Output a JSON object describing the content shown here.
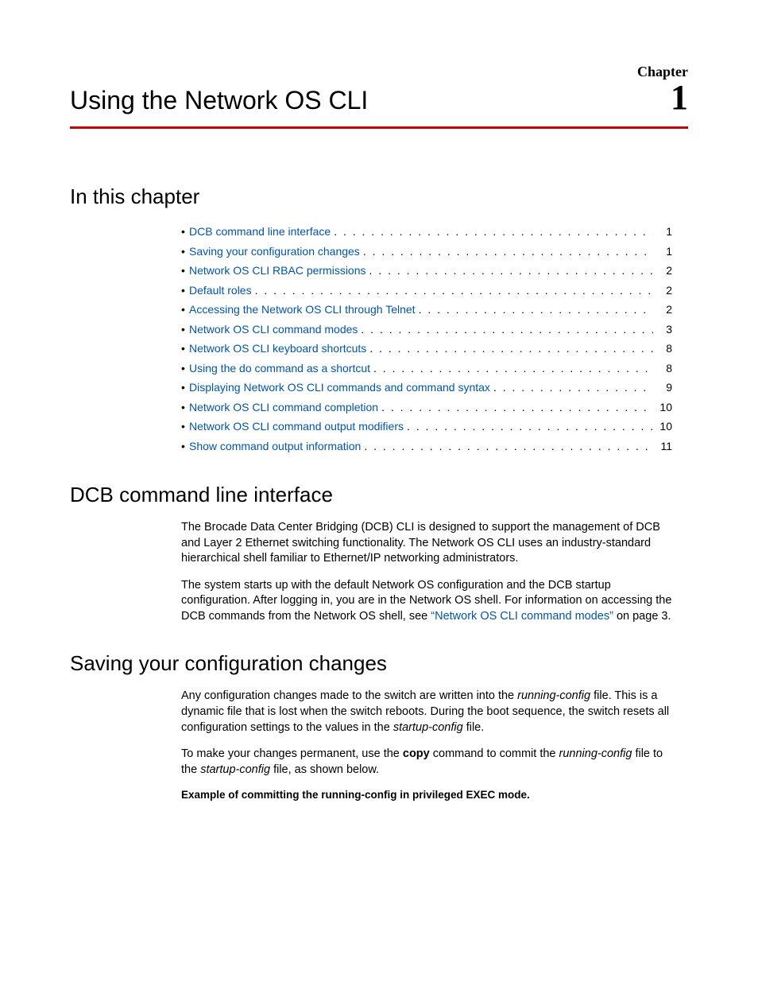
{
  "chapter": {
    "label": "Chapter",
    "number": "1",
    "title": "Using the Network OS CLI"
  },
  "sections": {
    "in_this_chapter": "In this chapter",
    "dcb": "DCB command line interface",
    "saving": "Saving your configuration changes"
  },
  "toc": [
    {
      "label": "DCB command line interface",
      "page": "1"
    },
    {
      "label": "Saving your configuration changes",
      "page": "1"
    },
    {
      "label": "Network OS CLI RBAC permissions",
      "page": "2"
    },
    {
      "label": "Default roles",
      "page": "2"
    },
    {
      "label": "Accessing the Network OS CLI through Telnet",
      "page": "2"
    },
    {
      "label": "Network OS CLI command modes",
      "page": "3"
    },
    {
      "label": "Network OS CLI keyboard shortcuts",
      "page": "8"
    },
    {
      "label": "Using the do command as a shortcut",
      "page": "8"
    },
    {
      "label": "Displaying Network OS CLI commands and command syntax",
      "page": "9"
    },
    {
      "label": "Network OS CLI command completion",
      "page": "10"
    },
    {
      "label": "Network OS CLI command output modifiers",
      "page": "10"
    },
    {
      "label": "Show command output information",
      "page": "11"
    }
  ],
  "body": {
    "dcb_p1": "The Brocade Data Center Bridging (DCB) CLI is designed to support the management of DCB and Layer 2 Ethernet switching functionality. The Network OS CLI uses an industry-standard hierarchical shell familiar to Ethernet/IP networking administrators.",
    "dcb_p2a": "The system starts up with the default Network OS configuration and the DCB startup configuration. After logging in, you are in the Network OS shell. For information on accessing the DCB commands from the Network OS shell, see ",
    "dcb_p2_xref": "“Network OS CLI command modes”",
    "dcb_p2b": " on page 3.",
    "saving_p1a": "Any configuration changes made to the switch are written into the ",
    "saving_p1_i1": "running-config",
    "saving_p1b": " file. This is a dynamic file that is lost when the switch reboots. During the boot sequence, the switch resets all configuration settings to the values in the ",
    "saving_p1_i2": "startup-config",
    "saving_p1c": " file.",
    "saving_p2a": "To make your changes permanent, use the ",
    "saving_p2_bold": "copy",
    "saving_p2b": " command to commit the ",
    "saving_p2_i1": "running-config",
    "saving_p2c": " file to the ",
    "saving_p2_i2": "startup-config",
    "saving_p2d": " file, as shown below.",
    "example_label": "Example  of committing the running-config in privileged EXEC mode."
  }
}
